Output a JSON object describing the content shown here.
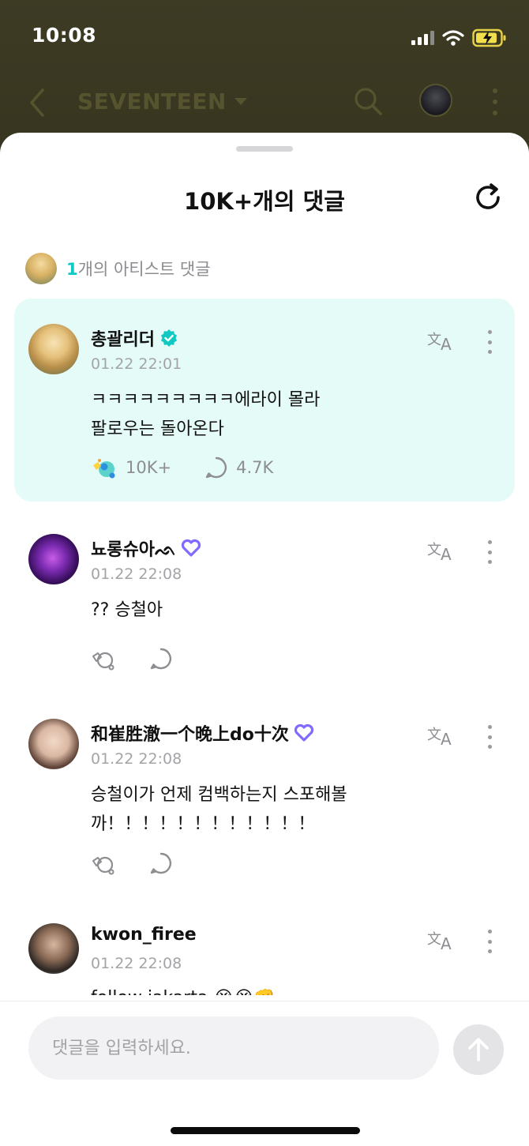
{
  "status_bar": {
    "time": "10:08"
  },
  "background_header": {
    "title": "SEVENTEEN"
  },
  "sheet": {
    "title": "10K+개의 댓글",
    "artist_summary": {
      "count": "1",
      "text": "개의 아티스트 댓글"
    }
  },
  "comments": [
    {
      "author": "총괄리더",
      "verified": true,
      "time": "01.22 22:01",
      "text": "ㅋㅋㅋㅋㅋㅋㅋㅋㅋ에라이 몰라\n팔로우는 돌아온다",
      "likes": "10K+",
      "replies": "4.7K",
      "featured": true
    },
    {
      "author": "뇨롱슈아ᨒ",
      "time": "01.22 22:08",
      "text": "?? 승철아"
    },
    {
      "author": "和崔胜澈一个晚上do十次",
      "time": "01.22 22:08",
      "text": "승철이가 언제 컴백하는지 스포해볼\n까！！！！！！！！！！！！"
    },
    {
      "author": "kwon_firee",
      "time": "01.22 22:08",
      "text": "follow jakarta 😭😭👊"
    }
  ],
  "input": {
    "placeholder": "댓글을 입력하세요."
  },
  "colors": {
    "accent": "#10c9c2",
    "featured_bg": "#e4fbf8",
    "membership_badge": "#7f6bff"
  },
  "icons": [
    "back-icon",
    "chevron-down-icon",
    "search-icon",
    "more-icon",
    "refresh-icon",
    "verified-badge-icon",
    "membership-heart-icon",
    "translate-icon",
    "like-icon",
    "reply-icon",
    "send-arrow-icon"
  ]
}
